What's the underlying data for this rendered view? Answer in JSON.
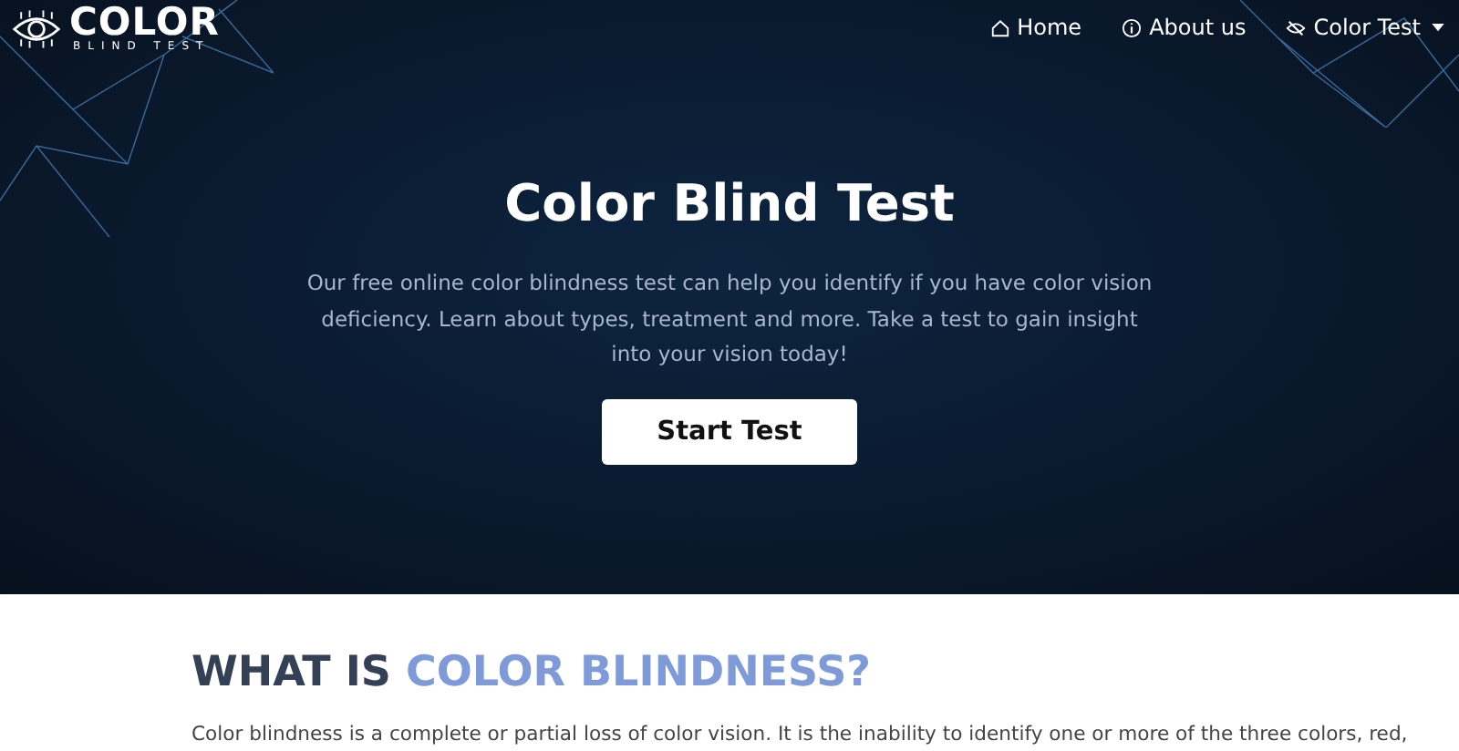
{
  "logo": {
    "title": "COLOR",
    "subtitle": "BLIND TEST"
  },
  "nav": [
    {
      "kind": "home",
      "label": "Home"
    },
    {
      "kind": "info",
      "label": "About us"
    },
    {
      "kind": "test",
      "label": "Color Test",
      "dropdown": true
    }
  ],
  "hero": {
    "title": "Color Blind Test",
    "text": "Our free online color blindness test can help you identify if you have color vision deficiency. Learn about types, treatment and more. Take a test to gain insight into your vision today!",
    "button": "Start Test"
  },
  "section": {
    "heading": "WHAT IS",
    "heading_highlight": "COLOR BLINDNESS?",
    "text": "Color blindness is a complete or partial loss of color vision. It is the inability to identify one or more of the three colors, red,"
  }
}
